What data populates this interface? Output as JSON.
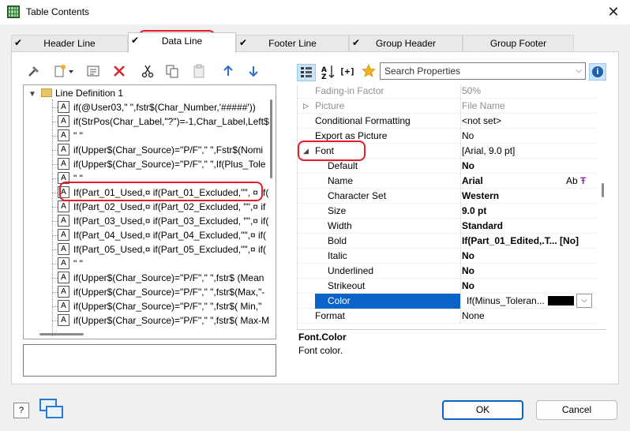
{
  "window": {
    "title": "Table Contents",
    "close_glyph": "✕"
  },
  "tabs": [
    {
      "label": "Header Line",
      "checked": true,
      "active": false
    },
    {
      "label": "Data Line",
      "checked": true,
      "active": true
    },
    {
      "label": "Footer Line",
      "checked": true,
      "active": false
    },
    {
      "label": "Group Header",
      "checked": true,
      "active": false
    },
    {
      "label": "Group Footer",
      "checked": false,
      "active": false
    }
  ],
  "left_toolbar": [
    "hammer-icon",
    "new-item-icon",
    "properties-icon",
    "delete-icon",
    "cut-icon",
    "copy-icon",
    "paste-icon",
    "move-up-icon",
    "move-down-icon"
  ],
  "tree": {
    "root_label": "Line Definition  1",
    "field_icon_glyph": "A",
    "rows": [
      "if(@User03,\" \",fstr$(Char_Number,'#####'))",
      "if(StrPos(Char_Label,\"?\")=-1,Char_Label,Left$",
      "\" \"",
      "if(Upper$(Char_Source)=\"P/F\",\" \",Fstr$(Nomi",
      "if(Upper$(Char_Source)=\"P/F\",\" \",If(Plus_Tole",
      "\" \"",
      "If(Part_01_Used,¤ if(Part_01_Excluded,\"\", ¤  if(",
      "If(Part_02_Used,¤ if(Part_02_Excluded, \"\",¤   if",
      "If(Part_03_Used,¤ if(Part_03_Excluded, \"\",¤   if(",
      "If(Part_04_Used,¤ if(Part_04_Excluded,\"\",¤   if(",
      "If(Part_05_Used,¤ if(Part_05_Excluded,\"\",¤   if(",
      "\" \"",
      "if(Upper$(Char_Source)=\"P/F\",\" \",fstr$ (Mean",
      "if(Upper$(Char_Source)=\"P/F\",\" \",fstr$(Max,\"-",
      "if(Upper$(Char_Source)=\"P/F\",\" \",fstr$( Min,\"",
      "if(Upper$(Char_Source)=\"P/F\",\" \",fstr$( Max-M"
    ]
  },
  "search": {
    "placeholder": "Search Properties"
  },
  "properties": [
    {
      "name": "Fading-in Factor",
      "value": "50%",
      "level": 0,
      "dim": true
    },
    {
      "name": "Picture",
      "value": "File Name",
      "level": 0,
      "dim": true,
      "expander": "▷"
    },
    {
      "name": "Conditional Formatting",
      "value": "<not set>",
      "level": 0
    },
    {
      "name": "Export as Picture",
      "value": "No",
      "level": 0
    },
    {
      "name": "Font",
      "value": "[Arial, 9.0 pt]",
      "level": 0,
      "expander": "◢"
    },
    {
      "name": "Default",
      "value": "No",
      "level": 1,
      "bold": true
    },
    {
      "name": "Name",
      "value": "Arial",
      "level": 1,
      "bold": true,
      "extra": "Ab"
    },
    {
      "name": "Character Set",
      "value": "Western",
      "level": 1,
      "bold": true
    },
    {
      "name": "Size",
      "value": "9.0 pt",
      "level": 1,
      "bold": true
    },
    {
      "name": "Width",
      "value": "Standard",
      "level": 1,
      "bold": true
    },
    {
      "name": "Bold",
      "value": "If(Part_01_Edited,.T... [No]",
      "level": 1,
      "bold": true
    },
    {
      "name": "Italic",
      "value": "No",
      "level": 1,
      "bold": true
    },
    {
      "name": "Underlined",
      "value": "No",
      "level": 1,
      "bold": true
    },
    {
      "name": "Strikeout",
      "value": "No",
      "level": 1,
      "bold": true
    },
    {
      "name": "Color",
      "value": "If(Minus_Toleran...",
      "level": 1,
      "selected": true
    },
    {
      "name": "Format",
      "value": "None",
      "level": 0
    }
  ],
  "description": {
    "title": "Font.Color",
    "text": "Font color."
  },
  "buttons": {
    "ok": "OK",
    "cancel": "Cancel",
    "help": "?"
  },
  "colors": {
    "accent": "#0a64c8",
    "highlight_oval": "#e21c2b",
    "color_value": "#000000"
  }
}
